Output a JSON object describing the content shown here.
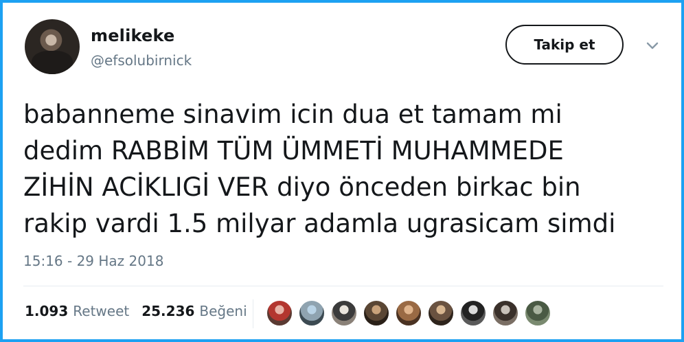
{
  "user": {
    "display_name": "melikeke",
    "handle": "@efsolubirnick"
  },
  "follow_button": {
    "label": "Takip et"
  },
  "tweet": {
    "lines": [
      "babanneme sinavim icin dua et tamam mi",
      "dedim RABBİM TÜM ÜMMETİ MUHAMMEDE",
      "ZİHİN ACİKLIGİ VER diyo önceden birkac bin",
      "rakip vardi 1.5 milyar adamla ugrasicam simdi"
    ],
    "timestamp": "15:16 - 29 Haz 2018"
  },
  "stats": {
    "retweets": {
      "count": "1.093",
      "label": "Retweet"
    },
    "likes": {
      "count": "25.236",
      "label": "Beğeni"
    }
  },
  "colors": {
    "frame": "#1da1f2",
    "text": "#14171a",
    "muted": "#657786"
  },
  "liker_avatars": [
    {
      "colors": [
        "#e8b4a8",
        "#b3362f",
        "#5a3a32"
      ]
    },
    {
      "colors": [
        "#b9d3e6",
        "#8fa3b0",
        "#3c4a52"
      ]
    },
    {
      "colors": [
        "#e9e4dc",
        "#3b3b3b",
        "#8a8178"
      ]
    },
    {
      "colors": [
        "#c9a27a",
        "#5a4634",
        "#2a2018"
      ]
    },
    {
      "colors": [
        "#e0b48c",
        "#9a6a44",
        "#4a3222"
      ]
    },
    {
      "colors": [
        "#d8b690",
        "#6a5240",
        "#2e241c"
      ]
    },
    {
      "colors": [
        "#d9d9d9",
        "#222222",
        "#5a5a5a"
      ]
    },
    {
      "colors": [
        "#c8c0b8",
        "#3a302a",
        "#7a6e64"
      ]
    },
    {
      "colors": [
        "#a9b4a0",
        "#4a5a44",
        "#7a8a70"
      ]
    }
  ]
}
